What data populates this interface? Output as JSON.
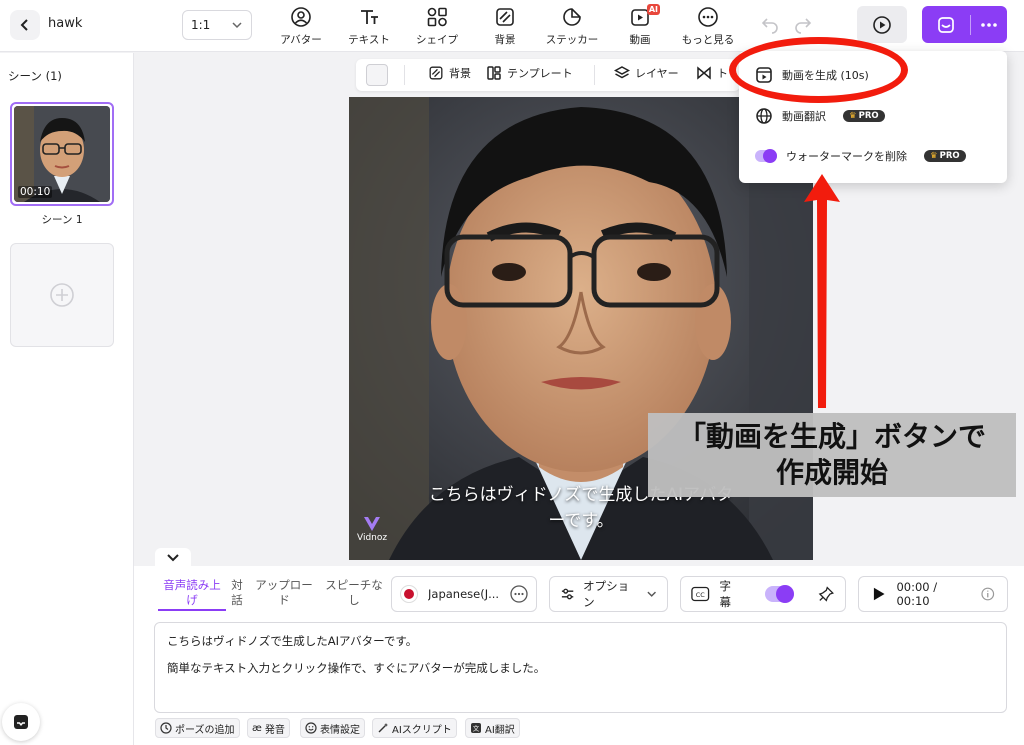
{
  "header": {
    "project_name": "hawk",
    "ratio": "1:1",
    "tools": [
      {
        "label": "アバター",
        "icon": "avatar-icon"
      },
      {
        "label": "テキスト",
        "icon": "text-icon"
      },
      {
        "label": "シェイプ",
        "icon": "shape-icon"
      },
      {
        "label": "背景",
        "icon": "background-icon"
      },
      {
        "label": "ステッカー",
        "icon": "sticker-icon"
      },
      {
        "label": "動画",
        "icon": "video-icon",
        "badge": "AI"
      },
      {
        "label": "もっと見る",
        "icon": "more-icon"
      }
    ]
  },
  "sidebar": {
    "title": "シーン (1)",
    "scenes": [
      {
        "label": "シーン 1",
        "duration": "00:10"
      }
    ]
  },
  "canvas_toolbar": {
    "items": [
      {
        "label": "背景",
        "icon": "background-icon"
      },
      {
        "label": "テンプレート",
        "icon": "template-icon"
      },
      {
        "label": "レイヤー",
        "icon": "layers-icon"
      },
      {
        "label": "ト",
        "icon": "transition-icon"
      }
    ]
  },
  "canvas": {
    "subtitle_line1": "こちらはヴィドノズで生成したAIアバタ",
    "subtitle_line2": "ーです。",
    "watermark": "Vidnoz"
  },
  "dropdown": {
    "items": [
      {
        "label": "動画を生成 (10s)",
        "icon": "video-generate-icon"
      },
      {
        "label": "動画翻訳",
        "icon": "globe-icon",
        "badge": "PRO"
      },
      {
        "label": "ウォーターマークを削除",
        "icon": "toggle-icon",
        "badge": "PRO"
      }
    ]
  },
  "annotation": {
    "line1": "「動画を生成」ボタンで",
    "line2": "作成開始",
    "color": "#f21c0d"
  },
  "script_panel": {
    "tabs": [
      {
        "label": "音声読み上げ",
        "active": true
      },
      {
        "label": "対話"
      },
      {
        "label": "アップロード"
      },
      {
        "label": "スピーチなし"
      }
    ],
    "language": "Japanese(J...",
    "options_label": "オプション",
    "subtitle_label": "字幕",
    "subtitle_on": true,
    "time": "00:00 / 00:10",
    "text_line1": "こちらはヴィドノズで生成したAIアバターです。",
    "text_line2": "簡単なテキスト入力とクリック操作で、すぐにアバターが完成しました。",
    "chips": [
      {
        "label": "ポーズの追加",
        "icon": "clock-icon"
      },
      {
        "label": "発音",
        "icon": "pronunciation-icon"
      },
      {
        "label": "表情設定",
        "icon": "smile-icon"
      },
      {
        "label": "AIスクリプト",
        "icon": "magic-wand-icon"
      },
      {
        "label": "AI翻訳",
        "icon": "translate-icon"
      }
    ]
  },
  "colors": {
    "accent": "#8b3df5",
    "annotation_red": "#f21c0d"
  }
}
